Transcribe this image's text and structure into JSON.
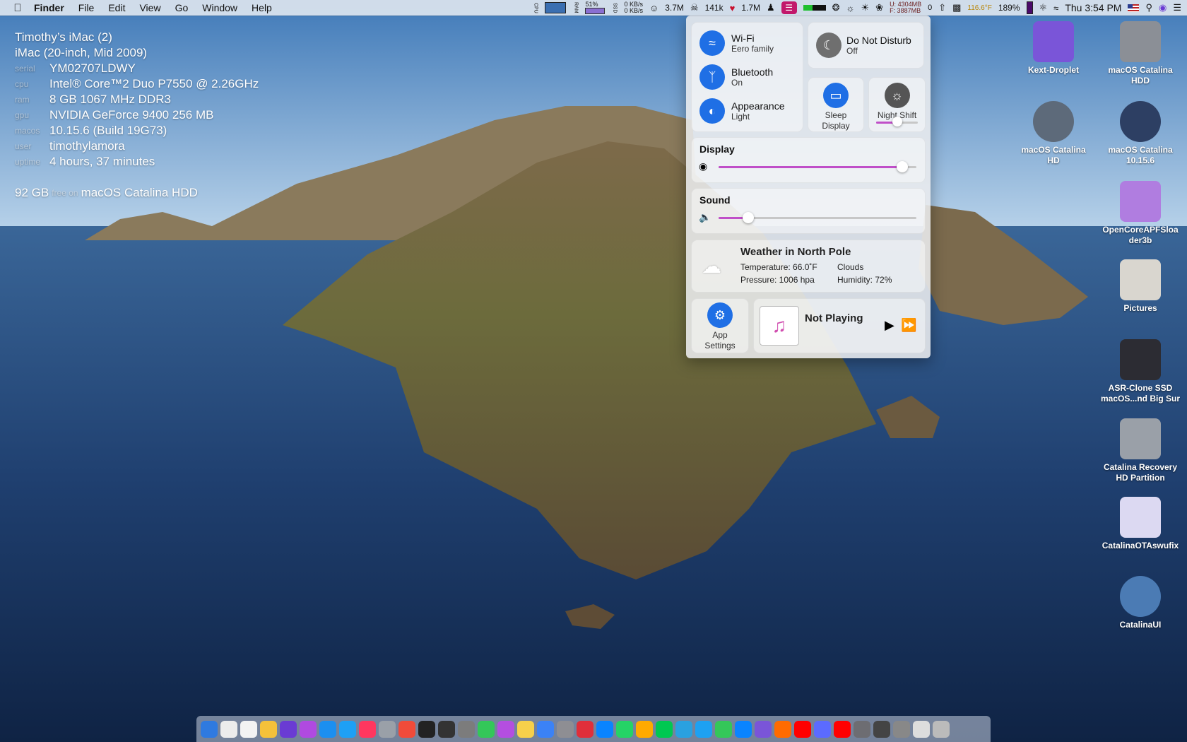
{
  "menubar": {
    "app_name": "Finder",
    "items": [
      "File",
      "Edit",
      "View",
      "Go",
      "Window",
      "Help"
    ],
    "cpu_label": "CPU",
    "ram_label": "RAM",
    "ram_pct": "51%",
    "ssd_label": "SSD",
    "net_up": "0 KB/s",
    "net_down": "0 KB/s",
    "stat1": "3.7M",
    "stat2": "141k",
    "stat3": "1.7M",
    "mem_used": "U: 4304MB",
    "mem_free": "F: 3887MB",
    "zero": "0",
    "temp": "116.6°F",
    "battery": "189%",
    "clock": "Thu 3:54 PM"
  },
  "system_info": {
    "title": "Timothy’s iMac (2)",
    "model": "iMac (20-inch, Mid 2009)",
    "rows": [
      {
        "key": "serial",
        "val": "YM02707LDWY"
      },
      {
        "key": "cpu",
        "val": "Intel® Core™2 Duo P7550 @ 2.26GHz"
      },
      {
        "key": "ram",
        "val": "8 GB 1067 MHz DDR3"
      },
      {
        "key": "gpu",
        "val": "NVIDIA GeForce 9400 256 MB"
      },
      {
        "key": "macos",
        "val": "10.15.6 (Build 19G73)"
      },
      {
        "key": "user",
        "val": "timothylamora"
      },
      {
        "key": "uptime",
        "val": "4 hours, 37 minutes"
      }
    ],
    "disk_free": "92 GB",
    "free_on": "free on",
    "disk_name": "macOS Catalina HDD"
  },
  "control_center": {
    "wifi": {
      "title": "Wi-Fi",
      "sub": "Eero family"
    },
    "bluetooth": {
      "title": "Bluetooth",
      "sub": "On"
    },
    "appearance": {
      "title": "Appearance",
      "sub": "Light"
    },
    "dnd": {
      "title": "Do Not Disturb",
      "sub": "Off"
    },
    "sleep": {
      "line1": "Sleep",
      "line2": "Display"
    },
    "night_shift": {
      "title": "Night Shift",
      "level": 0.5
    },
    "display": {
      "title": "Display",
      "level": 0.93
    },
    "sound": {
      "title": "Sound",
      "level": 0.15
    },
    "weather": {
      "title": "Weather in North Pole",
      "temperature": "Temperature: 66.0˚F",
      "condition": "Clouds",
      "pressure": "Pressure: 1006 hpa",
      "humidity": "Humidity: 72%"
    },
    "app_settings": {
      "line1": "App",
      "line2": "Settings"
    },
    "now_playing": "Not Playing"
  },
  "desktop_icons": [
    {
      "label1": "Kext-Droplet",
      "label2": "",
      "color": "#7a55d8"
    },
    {
      "label1": "macOS Catalina",
      "label2": "HDD",
      "color": "#8b8f96"
    },
    {
      "label1": "macOS Catalina",
      "label2": "HD",
      "color": "#5d6a7a"
    },
    {
      "label1": "macOS Catalina",
      "label2": "10.15.6",
      "color": "#2d3f63"
    },
    {
      "label1": "OpenCoreAPFSloa",
      "label2": "der3b",
      "color": "#b07de0"
    },
    {
      "label1": "Pictures",
      "label2": "",
      "color": "#d9d6cf"
    },
    {
      "label1": "ASR-Clone SSD",
      "label2": "macOS...nd Big Sur",
      "color": "#2c2c33"
    },
    {
      "label1": "Catalina Recovery",
      "label2": "HD Partition",
      "color": "#9aa0a8"
    },
    {
      "label1": "CatalinaOTAswufix",
      "label2": "",
      "color": "#dcd9f2"
    },
    {
      "label1": "CatalinaUI",
      "label2": "",
      "color": "#4b7bb4"
    }
  ],
  "dock": {
    "apps": [
      "#2f7ae0",
      "#ececec",
      "#f3f3f3",
      "#f4c13a",
      "#6a3bd3",
      "#b04ae0",
      "#1c8ff0",
      "#1ea0f5",
      "#ff375f",
      "#9aa0a8",
      "#f04b3a",
      "#222",
      "#333",
      "#7c7c7c",
      "#34c759",
      "#b44ee0",
      "#f7d04a",
      "#3b82f6",
      "#8e8e93",
      "#e02f3a",
      "#0a84ff",
      "#25d366",
      "#ffaa00",
      "#00c851",
      "#2aa1e0",
      "#1da1f2",
      "#34c759",
      "#0a84ff",
      "#7a55d8",
      "#ff6b00",
      "#ff0000",
      "#5b6bff",
      "#ff0000",
      "#6d6d72",
      "#444",
      "#888",
      "#ddd",
      "#bbb"
    ]
  }
}
